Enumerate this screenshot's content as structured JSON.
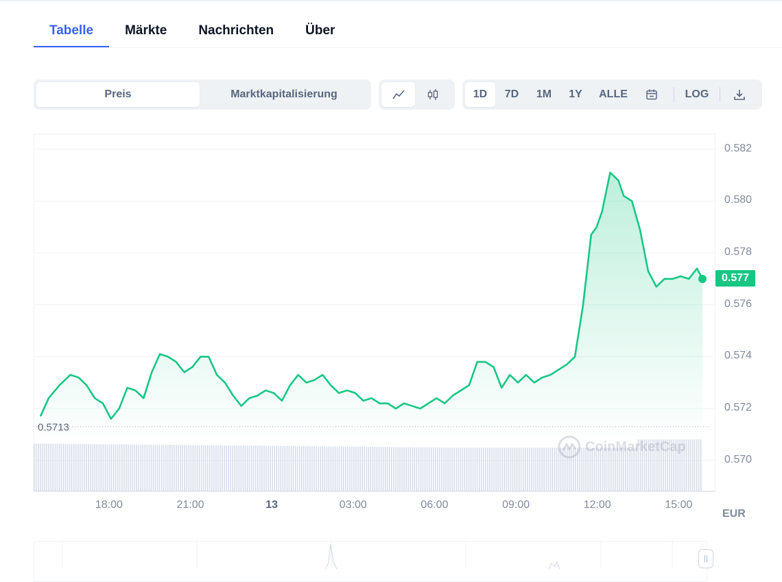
{
  "tabs": [
    "Tabelle",
    "Märkte",
    "Nachrichten",
    "Über"
  ],
  "chart_mode": {
    "options": [
      "Preis",
      "Marktkapitalisierung"
    ],
    "selected": "Preis"
  },
  "chart_type_icons": [
    "line-chart-icon",
    "candlestick-icon"
  ],
  "ranges": [
    "1D",
    "7D",
    "1M",
    "1Y",
    "ALLE"
  ],
  "selected_range": "1D",
  "log_label": "LOG",
  "icons": {
    "calendar": "calendar-icon",
    "download": "download-icon"
  },
  "currency": "EUR",
  "current_price": "0.577",
  "open_price_label": "0.5713",
  "watermark": "CoinMarketCap",
  "colors": {
    "accent": "#3861fb",
    "up": "#16c784",
    "text": "#0d1421",
    "muted": "#808a9d"
  },
  "chart_data": {
    "type": "area",
    "y_ticks": [
      "0.582",
      "0.580",
      "0.578",
      "0.576",
      "0.574",
      "0.572",
      "0.570"
    ],
    "x_ticks": [
      "18:00",
      "21:00",
      "13",
      "03:00",
      "06:00",
      "09:00",
      "12:00",
      "15:00"
    ],
    "ylim": [
      0.5688,
      0.5826
    ],
    "x_hours": [
      15.5,
      39.9
    ],
    "series": [
      {
        "x": [
          15.5,
          15.8,
          16.2,
          16.6,
          16.9,
          17.2,
          17.5,
          17.8,
          18.1,
          18.4,
          18.7,
          19.0,
          19.3,
          19.6,
          19.9,
          20.2,
          20.5,
          20.8,
          21.1,
          21.4,
          21.7,
          22.0,
          22.3,
          22.6,
          22.9,
          23.2,
          23.5,
          23.8,
          24.1,
          24.4,
          24.7,
          25.0,
          25.3,
          25.6,
          25.9,
          26.2,
          26.5,
          26.8,
          27.1,
          27.4,
          27.7,
          28.0,
          28.3,
          28.6,
          28.9,
          29.2,
          29.5,
          29.8,
          30.1,
          30.4,
          30.7,
          31.0,
          31.3,
          31.6,
          31.9,
          32.2,
          32.5,
          32.8,
          33.1,
          33.4,
          33.7,
          34.0,
          34.3,
          34.6,
          34.9,
          35.2,
          35.5,
          35.8,
          36.0,
          36.2,
          36.5,
          36.8,
          37.0,
          37.3,
          37.6,
          37.9,
          38.2,
          38.5,
          38.8,
          39.1,
          39.4,
          39.7,
          39.9
        ],
        "y": [
          0.5717,
          0.5724,
          0.5729,
          0.5733,
          0.5732,
          0.5729,
          0.5724,
          0.5722,
          0.5716,
          0.572,
          0.5728,
          0.5727,
          0.5724,
          0.5734,
          0.5741,
          0.574,
          0.5738,
          0.5734,
          0.5736,
          0.574,
          0.574,
          0.5733,
          0.573,
          0.5725,
          0.5721,
          0.5724,
          0.5725,
          0.5727,
          0.5726,
          0.5723,
          0.5729,
          0.5733,
          0.573,
          0.5731,
          0.5733,
          0.5729,
          0.5726,
          0.5727,
          0.5726,
          0.5723,
          0.5724,
          0.5722,
          0.5722,
          0.572,
          0.5722,
          0.5721,
          0.572,
          0.5722,
          0.5724,
          0.5722,
          0.5725,
          0.5727,
          0.5729,
          0.5738,
          0.5738,
          0.5736,
          0.5728,
          0.5733,
          0.573,
          0.5733,
          0.573,
          0.5732,
          0.5733,
          0.5735,
          0.5737,
          0.574,
          0.576,
          0.5787,
          0.579,
          0.5796,
          0.5811,
          0.5808,
          0.5802,
          0.58,
          0.5789,
          0.5773,
          0.5767,
          0.577,
          0.577,
          0.5771,
          0.577,
          0.5774,
          0.577
        ]
      }
    ],
    "volume_bars": 320
  }
}
